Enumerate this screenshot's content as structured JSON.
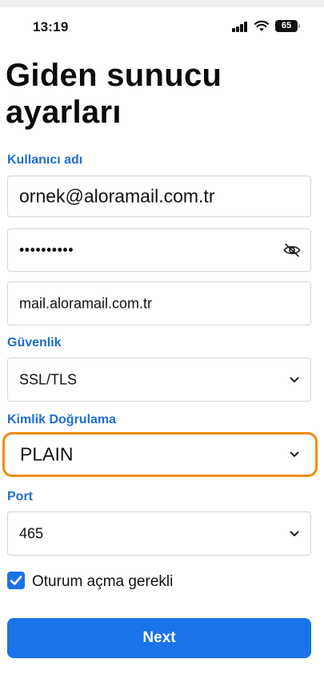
{
  "status_bar": {
    "time": "13:19",
    "battery": "65"
  },
  "page_title": "Giden sunucu ayarları",
  "username": {
    "label": "Kullanıcı adı",
    "value": "ornek@aloramail.com.tr"
  },
  "password": {
    "value": "••••••••••",
    "icon": "eye-slash-icon"
  },
  "server": {
    "value": "mail.aloramail.com.tr"
  },
  "security": {
    "label": "Güvenlik",
    "value": "SSL/TLS"
  },
  "auth": {
    "label": "Kimlik Doğrulama",
    "value": "PLAIN",
    "highlight_color": "#f28b0c"
  },
  "port": {
    "label": "Port",
    "value": "465"
  },
  "login_required": {
    "label": "Oturum açma gerekli",
    "checked": true
  },
  "next_button": {
    "label": "Next"
  },
  "colors": {
    "accent": "#1a73e8",
    "label_blue": "#1f6fd1"
  }
}
